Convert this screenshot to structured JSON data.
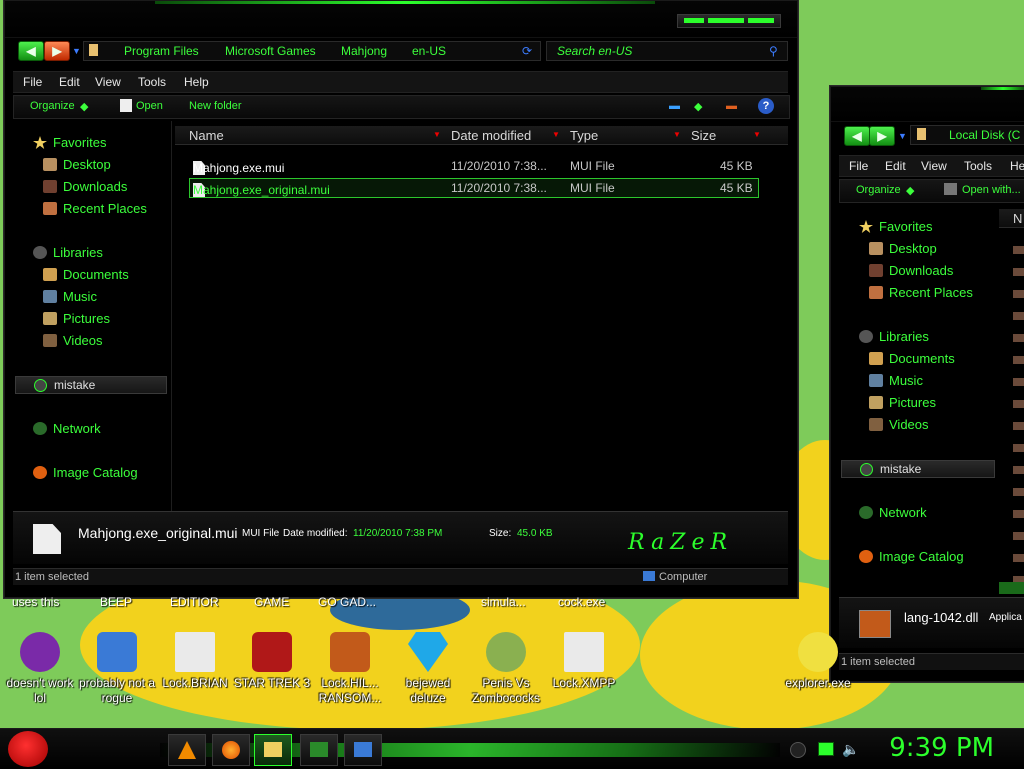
{
  "window_main": {
    "breadcrumb": [
      "Program Files",
      "Microsoft Games",
      "Mahjong",
      "en-US"
    ],
    "search_placeholder": "Search en-US",
    "menu": [
      "File",
      "Edit",
      "View",
      "Tools",
      "Help"
    ],
    "commands": {
      "organize": "Organize",
      "open": "Open",
      "new_folder": "New folder"
    },
    "nav": {
      "favorites": "Favorites",
      "desktop": "Desktop",
      "downloads": "Downloads",
      "recent": "Recent Places",
      "libraries": "Libraries",
      "documents": "Documents",
      "music": "Music",
      "pictures": "Pictures",
      "videos": "Videos",
      "homegroup": "mistake",
      "network": "Network",
      "catalog": "Image Catalog"
    },
    "columns": {
      "name": "Name",
      "date": "Date modified",
      "type": "Type",
      "size": "Size"
    },
    "files": [
      {
        "name": "Mahjong.exe.mui",
        "date": "11/20/2010 7:38...",
        "type": "MUI File",
        "size": "45 KB"
      },
      {
        "name": "Mahjong.exe_original.mui",
        "date": "11/20/2010 7:38...",
        "type": "MUI File",
        "size": "45 KB"
      }
    ],
    "details": {
      "filename": "Mahjong.exe_original.mui",
      "type_label": "MUI File",
      "date_label": "Date modified:",
      "date_value": "11/20/2010 7:38 PM",
      "size_label": "Size:",
      "size_value": "45.0 KB",
      "logo": "RaZeR"
    },
    "status": {
      "left": "1 item selected",
      "right": "Computer"
    }
  },
  "window_side": {
    "breadcrumb": "Local Disk (C",
    "menu": [
      "File",
      "Edit",
      "View",
      "Tools",
      "He"
    ],
    "commands": {
      "organize": "Organize",
      "open_with": "Open with..."
    },
    "col_name": "N",
    "nav": {
      "favorites": "Favorites",
      "desktop": "Desktop",
      "downloads": "Downloads",
      "recent": "Recent Places",
      "libraries": "Libraries",
      "documents": "Documents",
      "music": "Music",
      "pictures": "Pictures",
      "videos": "Videos",
      "homegroup": "mistake",
      "network": "Network",
      "catalog": "Image Catalog"
    },
    "details_filename": "lang-1042.dll",
    "details_type": "Applica",
    "status": "1 item selected"
  },
  "desktop": {
    "top_labels": [
      "uses this",
      "BEEP",
      "EDITIOR",
      "GAME",
      "GO GAD...",
      "simula...",
      "cock.exe"
    ],
    "icons": [
      {
        "label": "doesn't work lol",
        "icon": "yahoo-icon",
        "color": "#7a2aa8"
      },
      {
        "label": "probably not a rogue",
        "icon": "gear-icon",
        "color": "#3a7ad6"
      },
      {
        "label": "Lock.BRIAN",
        "icon": "document-icon",
        "color": "#eaeaea"
      },
      {
        "label": "STAR TREK 3",
        "icon": "star-wars-icon",
        "color": "#b01818"
      },
      {
        "label": "Lock.HIL... RANSOM...",
        "icon": "app-window-icon",
        "color": "#c25a1a"
      },
      {
        "label": "bejewed deluze",
        "icon": "gem-icon",
        "color": "#1fa8e8"
      },
      {
        "label": "Penis Vs Zombococks",
        "icon": "zombie-icon",
        "color": "#8ab050"
      },
      {
        "label": "Lock.XMPP",
        "icon": "document-icon",
        "color": "#eaeaea"
      },
      {
        "label": "explorer.exe",
        "icon": "eggs-icon",
        "color": "#f0e040"
      }
    ]
  },
  "taskbar": {
    "clock": "9:39 PM",
    "pinned": [
      "angry-birds-start-icon",
      "vlc-icon",
      "firefox-icon",
      "explorer-icon",
      "excel-icon",
      "paint-icon"
    ]
  }
}
